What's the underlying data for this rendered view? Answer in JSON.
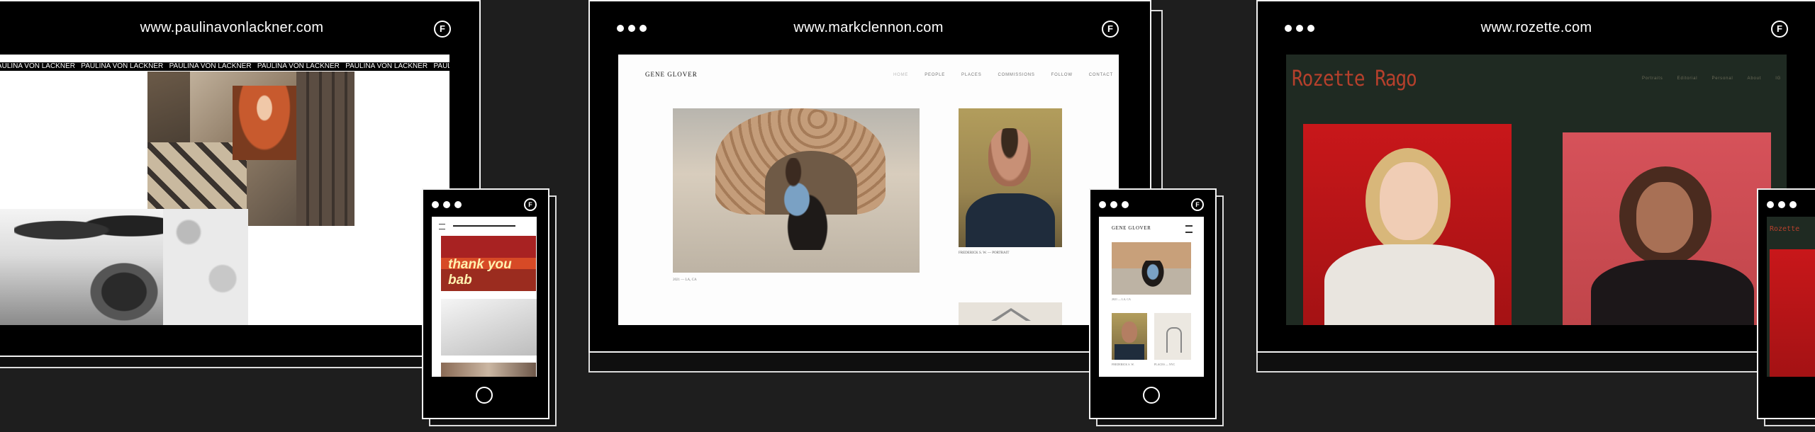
{
  "devices": [
    {
      "url": "www.paulinavonlackner.com",
      "logo_letter": "F"
    },
    {
      "url": "www.markclennon.com",
      "logo_letter": "F"
    },
    {
      "url": "www.rozette.com",
      "logo_letter": "F"
    }
  ],
  "paulina": {
    "marquee": "PAULINA VON LACKNER   PAULINA VON LACKNER   PAULINA VON LACKNER   PAULINA VON LACKNER   PAULINA VON LACKNER   PAULINA VON LACKNER   PAULINA VON LACKNER",
    "mobile_banner_text": "thank you bab"
  },
  "mark": {
    "brand": "GENE GLOVER",
    "nav": [
      "HOME",
      "PEOPLE",
      "PLACES",
      "COMMISSIONS",
      "FOLLOW",
      "CONTACT"
    ],
    "caption_main": "2021 — LA, CA",
    "caption_portrait": "FREDERICK S. W. — PORTRAIT",
    "mobile_brand": "GENE GLOVER",
    "mobile_caption_main": "2021 — LA, CA",
    "mobile_caption_portrait": "FREDERICK S. W.",
    "mobile_caption_arch": "PLACES — NYC"
  },
  "rozette": {
    "brand": "Rozette Rago",
    "nav": [
      "Portraits",
      "Editorial",
      "Personal",
      "About",
      "IG"
    ],
    "mobile_brand": "Rozette"
  },
  "colors": {
    "page_bg": "#1e1e1e",
    "frame_outline": "#f2f2f2",
    "rozette_brand": "#b6402c",
    "rozette_bg": "#1f2a22"
  },
  "icons": [
    "home-icon",
    "menu-icon",
    "logo-icon"
  ]
}
